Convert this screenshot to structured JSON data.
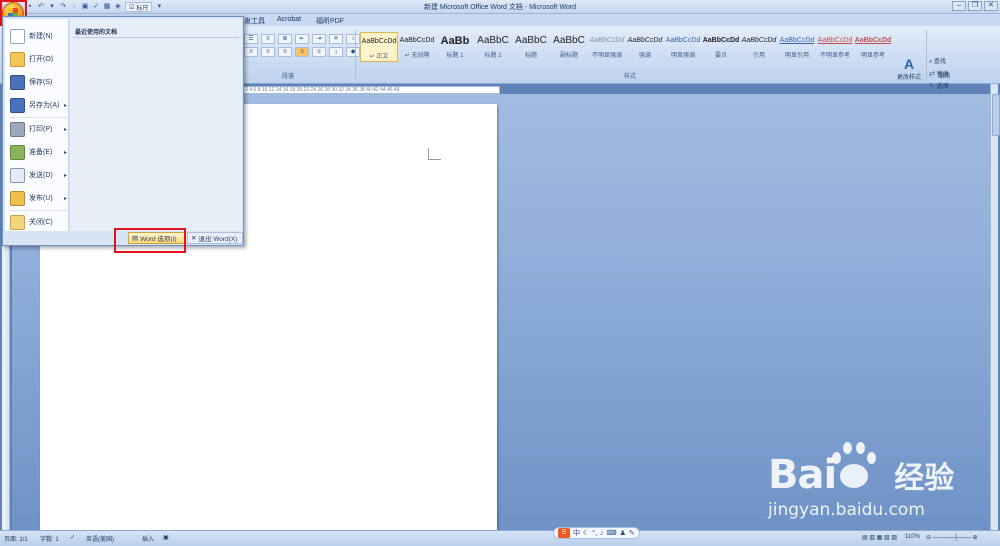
{
  "window": {
    "title": "新建 Microsoft Office Word 文档 - Microsoft Word"
  },
  "qat": {
    "ruler_label": "标尺"
  },
  "ribbon": {
    "tabs": [
      "发工具",
      "Acrobat",
      "福昕PDF"
    ],
    "groups": {
      "paragraph": "段落",
      "styles": "样式",
      "editing": "编辑"
    },
    "styles": [
      {
        "sample": "AaBbCcDd",
        "name": "↵ 正文"
      },
      {
        "sample": "AaBbCcDd",
        "name": "↵ 无间隔"
      },
      {
        "sample": "AaBb",
        "name": "标题 1"
      },
      {
        "sample": "AaBbC",
        "name": "标题 2"
      },
      {
        "sample": "AaBbC",
        "name": "标题"
      },
      {
        "sample": "AaBbC",
        "name": "副标题"
      },
      {
        "sample": "AaBbCcDd",
        "name": "不明显强调"
      },
      {
        "sample": "AaBbCcDd",
        "name": "强调"
      },
      {
        "sample": "AaBbCcDd",
        "name": "明显强调"
      },
      {
        "sample": "AaBbCcDd",
        "name": "要点"
      },
      {
        "sample": "AaBbCcDd",
        "name": "引用"
      },
      {
        "sample": "AaBbCcDd",
        "name": "明显引用"
      },
      {
        "sample": "AaBbCcDd",
        "name": "不明显参考"
      },
      {
        "sample": "AaBbCcDd",
        "name": "明显参考"
      }
    ],
    "change_styles": "更改样式",
    "editing": {
      "find": "查找",
      "replace": "替换",
      "select": "选择"
    }
  },
  "ruler": {
    "ticks": "1 2 4 6 8 10 12 14 16 18 20 22 24 26 28 30 32 34 36 38 40 42 44 46 48"
  },
  "office_menu": {
    "items": [
      {
        "label": "新建(N)",
        "icon": "new-document-icon",
        "submenu": false
      },
      {
        "label": "打开(O)",
        "icon": "open-folder-icon",
        "submenu": false
      },
      {
        "label": "保存(S)",
        "icon": "save-icon",
        "submenu": false
      },
      {
        "label": "另存为(A)",
        "icon": "save-as-icon",
        "submenu": true
      },
      {
        "label": "打印(P)",
        "icon": "print-icon",
        "submenu": true
      },
      {
        "label": "准备(E)",
        "icon": "prepare-icon",
        "submenu": true
      },
      {
        "label": "发送(D)",
        "icon": "send-icon",
        "submenu": true
      },
      {
        "label": "发布(U)",
        "icon": "publish-icon",
        "submenu": true
      },
      {
        "label": "关闭(C)",
        "icon": "close-folder-icon",
        "submenu": false
      }
    ],
    "recent_title": "最近使用的文档",
    "word_options": "Word 选项(I)",
    "exit_word": "退出 Word(X)"
  },
  "statusbar": {
    "page": "页面: 1/1",
    "words": "字数: 1",
    "language": "英语(美国)",
    "mode": "插入",
    "zoom": "110%"
  },
  "ime": {
    "logo": "S",
    "mode": "中"
  },
  "watermark": {
    "brand": "Bai",
    "brand_zh": "经验",
    "url": "jingyan.baidu.com"
  },
  "colors": {
    "highlight_box": "#e0121b",
    "ribbon": "#c8d9f0",
    "workspace": "#6f92c6"
  }
}
